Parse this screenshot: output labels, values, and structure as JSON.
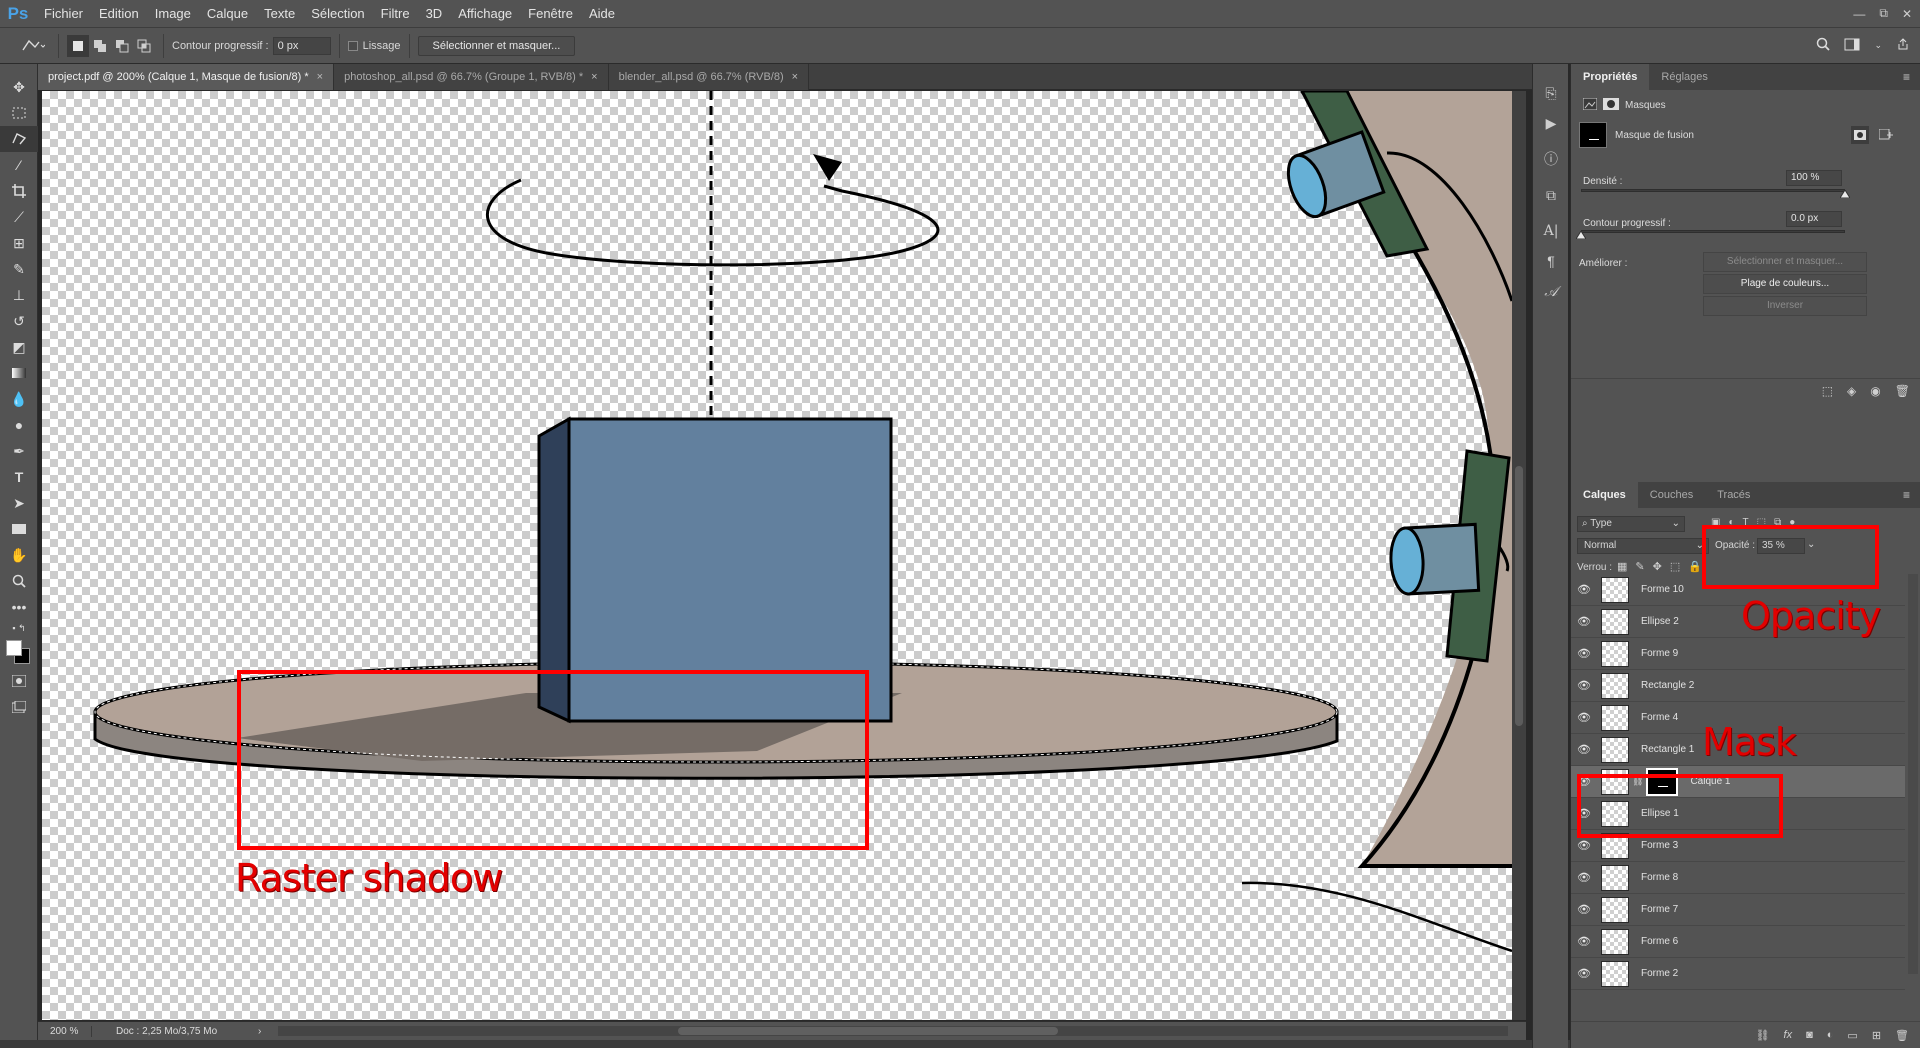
{
  "app": {
    "logo": "Ps"
  },
  "menu": [
    "Fichier",
    "Edition",
    "Image",
    "Calque",
    "Texte",
    "Sélection",
    "Filtre",
    "3D",
    "Affichage",
    "Fenêtre",
    "Aide"
  ],
  "window_controls": {
    "minimize": "—",
    "restore": "⧉",
    "close": "✕"
  },
  "options_bar": {
    "feather_label": "Contour progressif :",
    "feather_value": "0 px",
    "smoothing_label": "Lissage",
    "select_mask_button": "Sélectionner et masquer..."
  },
  "tabs": [
    {
      "label": "project.pdf @ 200% (Calque 1, Masque de fusion/8) *",
      "close": "×",
      "active": true
    },
    {
      "label": "photoshop_all.psd @ 66.7% (Groupe 1, RVB/8) *",
      "close": "×",
      "active": false
    },
    {
      "label": "blender_all.psd @ 66.7% (RVB/8)",
      "close": "×",
      "active": false
    }
  ],
  "status": {
    "zoom": "200 %",
    "doc": "Doc : 2,25 Mo/3,75 Mo",
    "arrow": "›"
  },
  "properties_panel": {
    "tabs": [
      "Propriétés",
      "Réglages"
    ],
    "section": "Masques",
    "mask_type": "Masque de fusion",
    "density_label": "Densité :",
    "density_value": "100 %",
    "density_level": 1.0,
    "feather_label": "Contour progressif :",
    "feather_value": "0.0 px",
    "feather_level": 0.0,
    "refine_label": "Améliorer :",
    "buttons": {
      "select_mask": "Sélectionner et masquer...",
      "color_range": "Plage de couleurs...",
      "invert": "Inverser"
    }
  },
  "layers_panel": {
    "tabs": [
      "Calques",
      "Couches",
      "Tracés"
    ],
    "filter": "Type",
    "blend_mode": "Normal",
    "opacity_label": "Opacité :",
    "opacity_value": "35 %",
    "lock_label": "Verrou :",
    "layers": [
      {
        "name": "Forme 10",
        "selected": false
      },
      {
        "name": "Ellipse 2",
        "selected": false
      },
      {
        "name": "Forme 9",
        "selected": false
      },
      {
        "name": "Rectangle 2",
        "selected": false
      },
      {
        "name": "Forme 4",
        "selected": false
      },
      {
        "name": "Rectangle 1",
        "selected": false
      },
      {
        "name": "Calque 1",
        "selected": true
      },
      {
        "name": "Ellipse 1",
        "selected": false
      },
      {
        "name": "Forme 3",
        "selected": false
      },
      {
        "name": "Forme 8",
        "selected": false
      },
      {
        "name": "Forme 7",
        "selected": false
      },
      {
        "name": "Forme 6",
        "selected": false
      },
      {
        "name": "Forme 2",
        "selected": false
      }
    ]
  },
  "annotations": {
    "raster_shadow": "Raster shadow",
    "opacity": "Opacity",
    "mask": "Mask"
  },
  "colors": {
    "annotation_red": "#ff0000",
    "cube_face": "#62809e",
    "cube_side": "#2f4059",
    "platform_top": "#b2a297",
    "platform_edge": "#8c8580",
    "shadow": "#756c66",
    "camera_body": "#6f8fa1",
    "camera_lens": "#66b0d6",
    "mount_green": "#3e5e45",
    "background_arc": "#b3a398"
  }
}
